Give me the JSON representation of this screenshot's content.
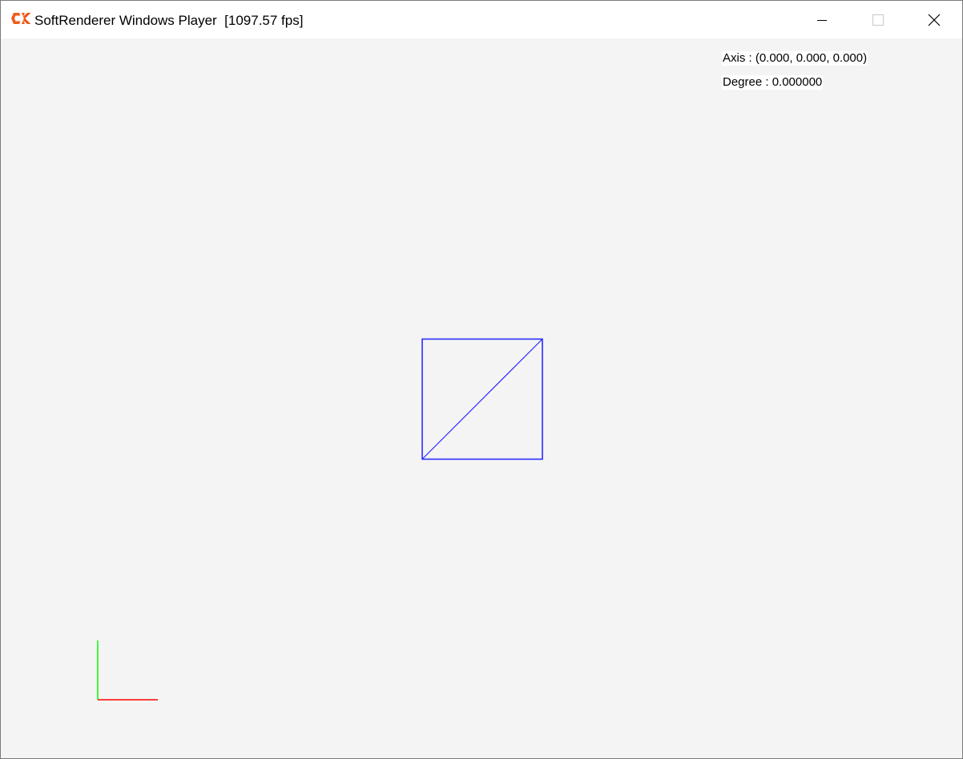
{
  "window": {
    "title": "SoftRenderer Windows Player  [1097.57 fps]",
    "icon": "ck-logo-icon",
    "controls": {
      "minimize": "minimize-icon",
      "maximize": "maximize-icon",
      "close": "close-icon"
    }
  },
  "hud": {
    "axis_text": "Axis : (0.000, 0.000, 0.000)",
    "degree_text": "Degree : 0.000000"
  },
  "scene": {
    "shape_color": "#2b2bff",
    "x_axis_color": "#ff0000",
    "y_axis_color": "#00ff00",
    "background": "#f4f4f4"
  }
}
